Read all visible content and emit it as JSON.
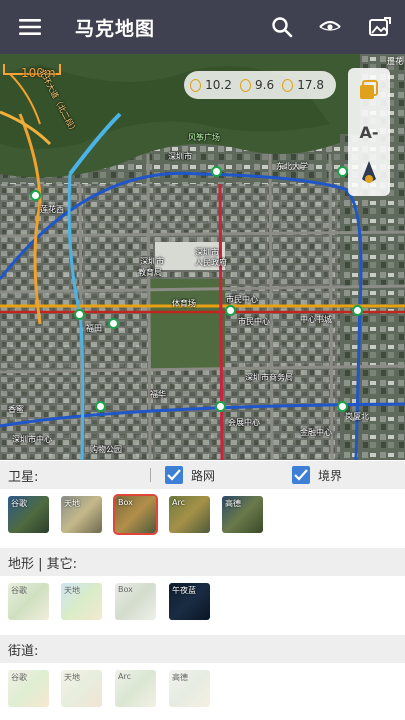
{
  "app": {
    "title": "马克地图"
  },
  "topbar": {
    "menu_icon": "menu-icon",
    "actions": [
      "search-icon",
      "eye-icon",
      "image-edit-icon"
    ]
  },
  "map": {
    "scale": "100m",
    "attribution": "遥花",
    "stats": [
      {
        "icon": "coin-icon",
        "value": "10.2"
      },
      {
        "icon": "coin-icon",
        "value": "9.6"
      },
      {
        "icon": "coin-icon",
        "value": "17.8"
      }
    ],
    "side_tools": [
      "layers-icon",
      "text-size-icon",
      "compass-icon"
    ],
    "side_text": "A-",
    "labels": {
      "fengzheng": "风筝广场",
      "shenzhen1": "深圳市",
      "lianhua": "莲花西",
      "dongbei": "东北大学",
      "shenzhen2": "深圳市",
      "jiaoyu": "教育局",
      "shenzhen3": "深圳市",
      "zhengfu": "人民政府",
      "shimin1": "市民中心",
      "shimin2": "市民中心",
      "tiyu": "体育场",
      "futian": "福田",
      "gouwu": "购物公园",
      "huizhan": "会展中心",
      "shiwu": "深圳市商务局",
      "xiangmi": "香蜜",
      "gangxia": "岗厦北",
      "fuhua": "福华",
      "xinzhou": "深圳市中心",
      "zhongxin": "中心书城",
      "jinrong": "金融中心"
    },
    "road_label": "北环大道（北二段）"
  },
  "panel": {
    "satellite": {
      "label": "卫星:",
      "checks": [
        {
          "label": "路网",
          "checked": true
        },
        {
          "label": "境界",
          "checked": true
        }
      ],
      "tiles": [
        {
          "label": "谷歌"
        },
        {
          "label": "天地"
        },
        {
          "label": "Box",
          "selected": true
        },
        {
          "label": "Arc"
        },
        {
          "label": "高德"
        }
      ]
    },
    "terrain": {
      "label": "地形 | 其它:",
      "tiles": [
        {
          "label": "谷歌"
        },
        {
          "label": "天地"
        },
        {
          "label": "Box"
        },
        {
          "label": "午夜蓝"
        }
      ]
    },
    "street": {
      "label": "街道:",
      "tiles": [
        {
          "label": "谷歌"
        },
        {
          "label": "天地"
        },
        {
          "label": "Arc"
        },
        {
          "label": "高德"
        }
      ]
    }
  }
}
